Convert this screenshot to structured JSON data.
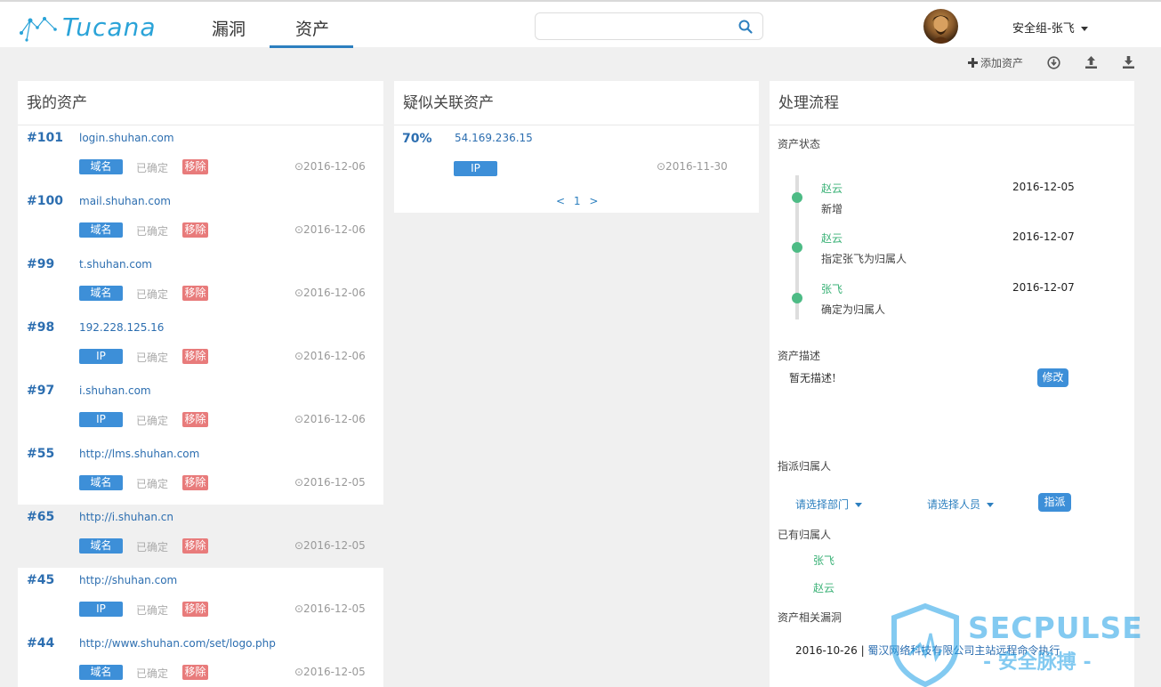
{
  "brand": {
    "logo_text": "Tucana"
  },
  "nav": {
    "tabs": [
      {
        "label": "漏洞"
      },
      {
        "label": "资产"
      }
    ]
  },
  "search": {
    "placeholder": ""
  },
  "user": {
    "name": "安全组-张飞"
  },
  "toolbar": {
    "add_label": "添加资产"
  },
  "colors": {
    "accent": "#2c7fbf",
    "tag_blue": "#3d8fd8",
    "tag_red": "#e87b7b",
    "green": "#3bb277"
  },
  "my_assets": {
    "title": "我的资产",
    "items": [
      {
        "id": "#101",
        "name": "login.shuhan.com",
        "type": "域名",
        "status": "已确定",
        "action": "移除",
        "date": "⊙2016-12-06"
      },
      {
        "id": "#100",
        "name": "mail.shuhan.com",
        "type": "域名",
        "status": "已确定",
        "action": "移除",
        "date": "⊙2016-12-06"
      },
      {
        "id": "#99",
        "name": "t.shuhan.com",
        "type": "域名",
        "status": "已确定",
        "action": "移除",
        "date": "⊙2016-12-06"
      },
      {
        "id": "#98",
        "name": "192.228.125.16",
        "type": "IP",
        "status": "已确定",
        "action": "移除",
        "date": "⊙2016-12-06"
      },
      {
        "id": "#97",
        "name": "i.shuhan.com",
        "type": "IP",
        "status": "已确定",
        "action": "移除",
        "date": "⊙2016-12-06"
      },
      {
        "id": "#55",
        "name": "http://lms.shuhan.com",
        "type": "域名",
        "status": "已确定",
        "action": "移除",
        "date": "⊙2016-12-05"
      },
      {
        "id": "#65",
        "name": "http://i.shuhan.cn",
        "type": "域名",
        "status": "已确定",
        "action": "移除",
        "date": "⊙2016-12-05"
      },
      {
        "id": "#45",
        "name": "http://shuhan.com",
        "type": "IP",
        "status": "已确定",
        "action": "移除",
        "date": "⊙2016-12-05"
      },
      {
        "id": "#44",
        "name": "http://www.shuhan.com/set/logo.php",
        "type": "域名",
        "status": "已确定",
        "action": "移除",
        "date": "⊙2016-12-05"
      }
    ]
  },
  "related": {
    "title": "疑似关联资产",
    "item": {
      "percent": "70%",
      "ip": "54.169.236.15",
      "type": "IP",
      "date": "⊙2016-11-30"
    },
    "pager": {
      "prev": "<",
      "page": "1",
      "next": ">"
    }
  },
  "process": {
    "title": "处理流程",
    "status_label": "资产状态",
    "timeline": [
      {
        "who": "赵云",
        "action": "新增",
        "date": "2016-12-05"
      },
      {
        "who": "赵云",
        "action": "指定张飞为归属人",
        "date": "2016-12-07"
      },
      {
        "who": "张飞",
        "action": "确定为归属人",
        "date": "2016-12-07"
      }
    ],
    "desc_label": "资产描述",
    "desc_text": "暂无描述!",
    "edit_btn": "修改",
    "assign_label": "指派归属人",
    "dept_select": "请选择部门",
    "person_select": "请选择人员",
    "assign_btn": "指派",
    "owners_label": "已有归属人",
    "owners": [
      "张飞",
      "赵云"
    ],
    "vuln_label": "资产相关漏洞",
    "vuln": {
      "date": "2016-10-26",
      "sep": " | ",
      "title": "蜀汉网络科技有限公司主站远程命令执行"
    }
  },
  "watermark": {
    "text": "SECPULSE",
    "sub": "- 安全脉搏 -"
  }
}
